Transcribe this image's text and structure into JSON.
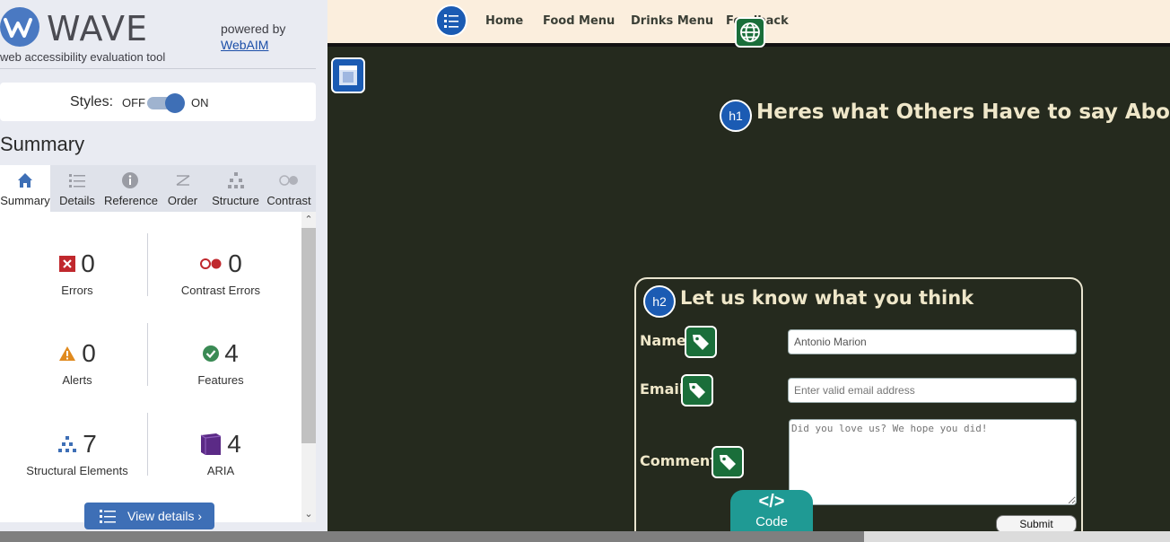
{
  "wave": {
    "title": "WAVE",
    "tagline": "web accessibility evaluation tool",
    "powered_by": "powered by",
    "webaim_link": "WebAIM",
    "styles_label": "Styles:",
    "styles_off": "OFF",
    "styles_on": "ON",
    "summary_heading": "Summary",
    "tabs": [
      {
        "label": "Summary",
        "icon": "home-icon"
      },
      {
        "label": "Details",
        "icon": "list-icon"
      },
      {
        "label": "Reference",
        "icon": "info-icon"
      },
      {
        "label": "Order",
        "icon": "order-icon"
      },
      {
        "label": "Structure",
        "icon": "structure-icon"
      },
      {
        "label": "Contrast",
        "icon": "contrast-icon"
      }
    ],
    "active_tab": "Summary",
    "stats": {
      "errors": {
        "count": "0",
        "label": "Errors"
      },
      "contrast_errors": {
        "count": "0",
        "label": "Contrast Errors"
      },
      "alerts": {
        "count": "0",
        "label": "Alerts"
      },
      "features": {
        "count": "4",
        "label": "Features"
      },
      "structural": {
        "count": "7",
        "label": "Structural Elements"
      },
      "aria": {
        "count": "4",
        "label": "ARIA"
      }
    },
    "view_details": "View details ›"
  },
  "site": {
    "nav": [
      "Home",
      "Food Menu",
      "Drinks Menu",
      "Feedback"
    ],
    "heading": "Heres what Others Have to say About Us",
    "form": {
      "title": "Let us know what you think",
      "name_label": "Name:",
      "name_value": "Antonio Marion",
      "email_label": "Email:",
      "email_placeholder": "Enter valid email address",
      "comments_label": "Comments",
      "comments_placeholder": "Did you love us? We hope you did!",
      "submit": "Submit"
    },
    "badges": {
      "h1": "h1",
      "h2": "h2"
    },
    "code_tab": {
      "icon": "</>",
      "label": "Code"
    }
  },
  "colors": {
    "wave_blue": "#3e6fb6",
    "site_bg": "#252a1e",
    "nav_bg": "#fbeedd",
    "error_red": "#c0282d",
    "alert_orange": "#e08a1e",
    "feature_green": "#3a8a54",
    "aria_purple": "#5b2a86",
    "code_teal": "#1f9a94"
  }
}
